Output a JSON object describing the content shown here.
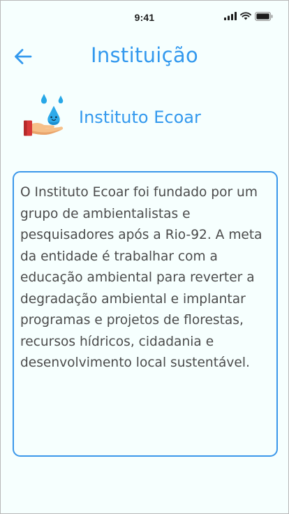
{
  "status_bar": {
    "time": "9:41"
  },
  "header": {
    "title": "Instituição"
  },
  "organization": {
    "name": "Instituto Ecoar",
    "logo_icon": "water-drops-hand-icon"
  },
  "description": {
    "text": "O Instituto Ecoar foi fundado por um grupo de ambientalistas e pesquisadores após a Rio-92. A meta da entidade é trabalhar com a educação ambiental para reverter a degradação ambiental e implantar programas e projetos de florestas, recursos hídricos, cidadania e desenvolvimento local sustentável."
  },
  "colors": {
    "accent": "#3399ee",
    "background": "#f6fffe",
    "text": "#4b4b4b",
    "border": "#3a97ea"
  }
}
